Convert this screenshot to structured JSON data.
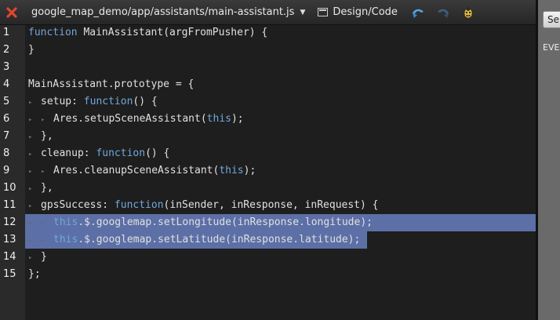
{
  "toolbar": {
    "file_path": "google_map_demo/app/assistants/main-assistant.js",
    "design_code_label": "Design/Code",
    "close_color": "#e0452f"
  },
  "editor": {
    "selection_color": "#5c6fa6",
    "keyword_color": "#6fa8dc",
    "lines": [
      {
        "n": "1",
        "indent": 0,
        "tokens": [
          [
            "kw",
            "function"
          ],
          [
            "t",
            " MainAssistant(argFromPusher) {"
          ]
        ]
      },
      {
        "n": "2",
        "indent": 0,
        "tokens": [
          [
            "t",
            "}"
          ]
        ]
      },
      {
        "n": "3",
        "indent": 0,
        "tokens": []
      },
      {
        "n": "4",
        "indent": 0,
        "tokens": [
          [
            "t",
            "MainAssistant.prototype = {"
          ]
        ]
      },
      {
        "n": "5",
        "indent": 1,
        "tokens": [
          [
            "t",
            "setup: "
          ],
          [
            "kw",
            "function"
          ],
          [
            "t",
            "() {"
          ]
        ]
      },
      {
        "n": "6",
        "indent": 2,
        "tokens": [
          [
            "t",
            "Ares.setupSceneAssistant("
          ],
          [
            "kw",
            "this"
          ],
          [
            "t",
            ");"
          ]
        ]
      },
      {
        "n": "7",
        "indent": 1,
        "tokens": [
          [
            "t",
            "},"
          ]
        ]
      },
      {
        "n": "8",
        "indent": 1,
        "tokens": [
          [
            "t",
            "cleanup: "
          ],
          [
            "kw",
            "function"
          ],
          [
            "t",
            "() {"
          ]
        ]
      },
      {
        "n": "9",
        "indent": 2,
        "tokens": [
          [
            "t",
            "Ares.cleanupSceneAssistant("
          ],
          [
            "kw",
            "this"
          ],
          [
            "t",
            ");"
          ]
        ]
      },
      {
        "n": "10",
        "indent": 1,
        "tokens": [
          [
            "t",
            "},"
          ]
        ]
      },
      {
        "n": "11",
        "indent": 1,
        "tokens": [
          [
            "t",
            "gpsSuccess: "
          ],
          [
            "kw",
            "function"
          ],
          [
            "t",
            "(inSender, inResponse, inRequest) {"
          ]
        ]
      },
      {
        "n": "12",
        "indent": 2,
        "selected": "full",
        "tokens": [
          [
            "kw",
            "this"
          ],
          [
            "t",
            ".$.googlemap.setLongitude(inResponse.longitude);"
          ]
        ]
      },
      {
        "n": "13",
        "indent": 2,
        "selected": "partial",
        "tokens": [
          [
            "kw",
            "this"
          ],
          [
            "t",
            ".$.googlemap.setLatitude(inResponse.latitude);"
          ]
        ]
      },
      {
        "n": "14",
        "indent": 1,
        "tokens": [
          [
            "t",
            "}"
          ]
        ]
      },
      {
        "n": "15",
        "indent": 0,
        "tokens": [
          [
            "t",
            "};"
          ]
        ]
      }
    ]
  },
  "right_panel": {
    "button_label": "Se",
    "label": "EVE"
  }
}
